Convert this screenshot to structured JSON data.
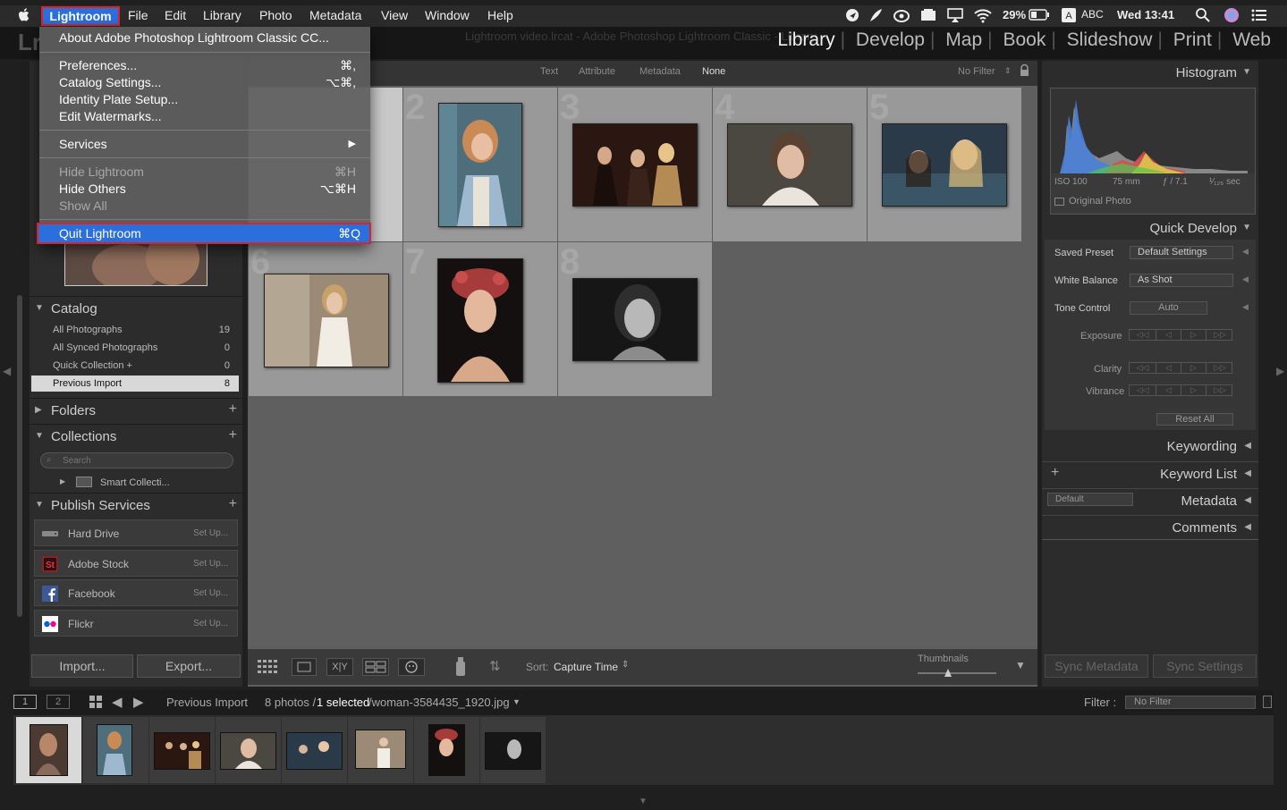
{
  "menubar": {
    "app_menu": "Lightroom",
    "items": [
      "File",
      "Edit",
      "Library",
      "Photo",
      "Metadata",
      "View",
      "Window",
      "Help"
    ],
    "battery": "29%",
    "input_source": "ABC",
    "clock": "Wed 13:41"
  },
  "window": {
    "logo": "Lr",
    "title": "Lightroom video.lrcat - Adobe Photoshop Lightroom Classic - Library"
  },
  "modules": [
    "Library",
    "Develop",
    "Map",
    "Book",
    "Slideshow",
    "Print",
    "Web"
  ],
  "active_module": "Library",
  "app_menu": {
    "about": "About Adobe Photoshop Lightroom Classic CC...",
    "preferences": "Preferences...",
    "preferences_key": "⌘,",
    "catalog_settings": "Catalog Settings...",
    "catalog_settings_key": "⌥⌘,",
    "identity_plate": "Identity Plate Setup...",
    "edit_watermarks": "Edit Watermarks...",
    "services": "Services",
    "hide": "Hide Lightroom",
    "hide_key": "⌘H",
    "hide_others": "Hide Others",
    "hide_others_key": "⌥⌘H",
    "show_all": "Show All",
    "quit": "Quit Lightroom",
    "quit_key": "⌘Q"
  },
  "filter_bar": {
    "text": "Text",
    "attribute": "Attribute",
    "metadata": "Metadata",
    "none": "None",
    "preset": "No Filter"
  },
  "catalog": {
    "title": "Catalog",
    "rows": [
      {
        "label": "All Photographs",
        "count": "19"
      },
      {
        "label": "All Synced Photographs",
        "count": "0"
      },
      {
        "label": "Quick Collection +",
        "count": "0"
      },
      {
        "label": "Previous Import",
        "count": "8"
      }
    ]
  },
  "folders": {
    "title": "Folders"
  },
  "collections": {
    "title": "Collections",
    "search_placeholder": "Search",
    "smart": "Smart Collecti..."
  },
  "publish": {
    "title": "Publish Services",
    "services": [
      {
        "label": "Hard Drive",
        "action": "Set Up..."
      },
      {
        "label": "Adobe Stock",
        "action": "Set Up..."
      },
      {
        "label": "Facebook",
        "action": "Set Up..."
      },
      {
        "label": "Flickr",
        "action": "Set Up..."
      }
    ]
  },
  "left_buttons": {
    "import": "Import...",
    "export": "Export..."
  },
  "grid": {
    "numbers": [
      "2",
      "3",
      "4",
      "5",
      "6",
      "7",
      "8"
    ]
  },
  "toolbar": {
    "sort_label": "Sort:",
    "sort_value": "Capture Time",
    "thumbnails": "Thumbnails"
  },
  "histogram": {
    "title": "Histogram",
    "iso": "ISO 100",
    "focal": "75 mm",
    "aperture": "ƒ / 7.1",
    "shutter": "¹⁄₁₂₅ sec",
    "original_photo": "Original Photo"
  },
  "quick_develop": {
    "title": "Quick Develop",
    "saved_preset_label": "Saved Preset",
    "saved_preset_value": "Default Settings",
    "white_balance_label": "White Balance",
    "white_balance_value": "As Shot",
    "tone_control_label": "Tone Control",
    "auto": "Auto",
    "exposure": "Exposure",
    "clarity": "Clarity",
    "vibrance": "Vibrance",
    "reset_all": "Reset All"
  },
  "right_sections": {
    "keywording": "Keywording",
    "keyword_list": "Keyword List",
    "metadata": "Metadata",
    "metadata_preset": "Default",
    "comments": "Comments"
  },
  "sync": {
    "metadata": "Sync Metadata",
    "settings": "Sync Settings"
  },
  "filmstrip_bar": {
    "screen1": "1",
    "screen2": "2",
    "source": "Previous Import",
    "count": "8 photos /",
    "selected": "1 selected",
    "filename": "/woman-3584435_1920.jpg",
    "filter_label": "Filter :",
    "filter_value": "No Filter"
  },
  "colors": {
    "selection_blue": "#2a6fdc",
    "highlight_red": "#d8232a"
  }
}
